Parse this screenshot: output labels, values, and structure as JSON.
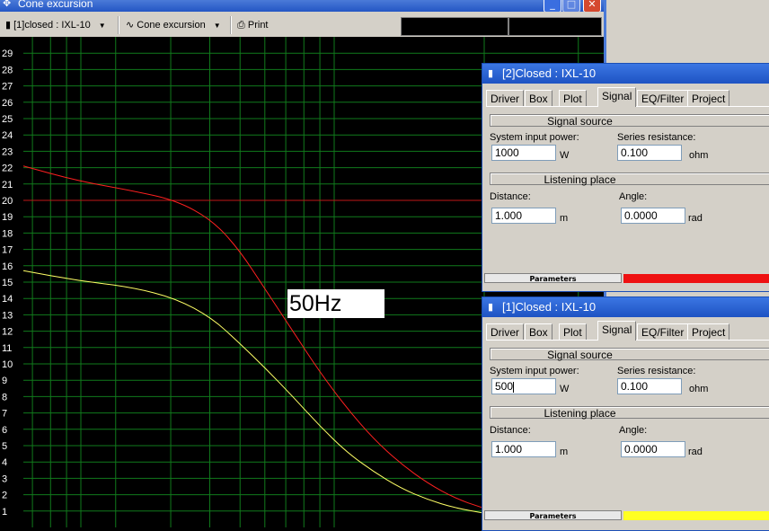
{
  "main_window": {
    "title": "Cone excursion",
    "toolbar": {
      "project_select": "[1]closed : IXL-10",
      "view_select": "Cone excursion",
      "print_label": "Print"
    },
    "overlay_label": "50Hz",
    "y_ticks": [
      "29",
      "28",
      "27",
      "26",
      "25",
      "24",
      "23",
      "22",
      "21",
      "20",
      "19",
      "18",
      "17",
      "16",
      "15",
      "14",
      "13",
      "12",
      "11",
      "10",
      "9",
      "8",
      "7",
      "6",
      "5",
      "4",
      "3",
      "2",
      "1"
    ]
  },
  "chart_data": {
    "type": "line",
    "title": "",
    "xlabel": "",
    "ylabel": "",
    "ylim": [
      0,
      30
    ],
    "x_scale": "log",
    "grid": true,
    "legend": "none",
    "reference_lines": [
      {
        "y": 20,
        "color": "#c01818"
      }
    ],
    "series": [
      {
        "color": "#ff2020",
        "points": [
          [
            0,
            22.1
          ],
          [
            60,
            21.2
          ],
          [
            120,
            20.6
          ],
          [
            170,
            20.0
          ],
          [
            210,
            18.8
          ],
          [
            240,
            17.0
          ],
          [
            270,
            14.5
          ],
          [
            300,
            12.0
          ],
          [
            330,
            9.5
          ],
          [
            360,
            7.3
          ],
          [
            390,
            5.4
          ],
          [
            420,
            3.9
          ],
          [
            450,
            2.7
          ],
          [
            480,
            1.8
          ],
          [
            510,
            1.2
          ],
          [
            540,
            0.8
          ],
          [
            580,
            0.4
          ]
        ]
      },
      {
        "color": "#ffff66",
        "points": [
          [
            0,
            15.7
          ],
          [
            60,
            15.1
          ],
          [
            120,
            14.7
          ],
          [
            170,
            14.0
          ],
          [
            210,
            12.8
          ],
          [
            240,
            11.3
          ],
          [
            270,
            9.7
          ],
          [
            300,
            8.0
          ],
          [
            330,
            6.2
          ],
          [
            360,
            4.6
          ],
          [
            390,
            3.4
          ],
          [
            420,
            2.4
          ],
          [
            450,
            1.7
          ],
          [
            480,
            1.2
          ],
          [
            510,
            0.9
          ],
          [
            540,
            0.6
          ],
          [
            580,
            0.3
          ]
        ]
      }
    ]
  },
  "dialogs": [
    {
      "title": "[2]Closed : IXL-10",
      "tabs": [
        "Driver",
        "Box",
        "Plot",
        "Signal",
        "EQ/Filter",
        "Project"
      ],
      "active_tab": "Signal",
      "signal_source": "Signal source",
      "power_label": "System input power:",
      "power_value": "1000",
      "power_unit": "W",
      "resistance_label": "Series resistance:",
      "resistance_value": "0.100",
      "resistance_unit": "ohm",
      "listening": "Listening place",
      "distance_label": "Distance:",
      "distance_value": "1.000",
      "distance_unit": "m",
      "angle_label": "Angle:",
      "angle_value": "0.0000",
      "angle_unit": "rad",
      "status_label": "Parameters",
      "status_color": "#ee1111"
    },
    {
      "title": "[1]Closed : IXL-10",
      "tabs": [
        "Driver",
        "Box",
        "Plot",
        "Signal",
        "EQ/Filter",
        "Project"
      ],
      "active_tab": "Signal",
      "signal_source": "Signal source",
      "power_label": "System input power:",
      "power_value": "500",
      "power_unit": "W",
      "resistance_label": "Series resistance:",
      "resistance_value": "0.100",
      "resistance_unit": "ohm",
      "listening": "Listening place",
      "distance_label": "Distance:",
      "distance_value": "1.000",
      "distance_unit": "m",
      "angle_label": "Angle:",
      "angle_value": "0.0000",
      "angle_unit": "rad",
      "status_label": "Parameters",
      "status_color": "#ffff22"
    }
  ],
  "icons": {
    "window": "app-window-icon",
    "dialog": "dialog-window-icon",
    "wave": "sine-wave-icon",
    "printer": "printer-icon"
  }
}
